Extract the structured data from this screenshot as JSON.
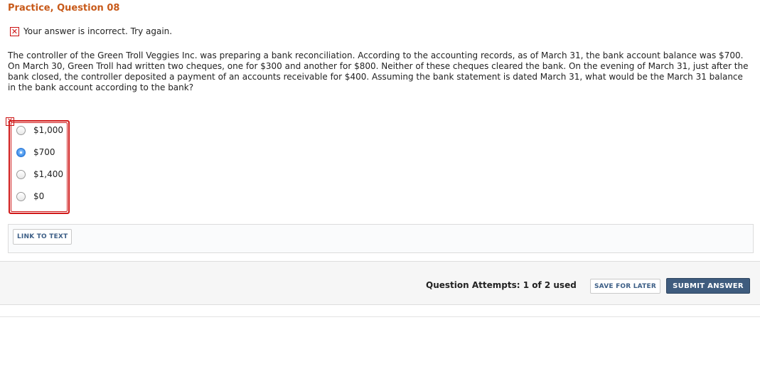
{
  "question": {
    "title": "Practice, Question 08",
    "feedback_icon": "x-icon",
    "feedback_text": "Your answer is incorrect.  Try again.",
    "text": "The controller of the Green Troll Veggies Inc. was preparing a bank reconciliation. According to the accounting records, as of March 31, the bank account balance was $700. On March 30, Green Troll had written two cheques, one for $300 and another for $800. Neither of these cheques cleared the bank. On the evening of March 31, just after the bank closed, the controller deposited a payment of an accounts receivable for $400. Assuming the bank statement is dated March 31, what would be the March 31 balance in the bank account according to the bank?"
  },
  "choices": {
    "marker_icon": "x-icon",
    "selected_index": 1,
    "items": [
      {
        "label": "$1,000"
      },
      {
        "label": "$700"
      },
      {
        "label": "$1,400"
      },
      {
        "label": "$0"
      }
    ]
  },
  "links": {
    "link_to_text": "LINK TO TEXT"
  },
  "footer": {
    "attempts": "Question Attempts: 1 of 2 used",
    "save_label": "SAVE FOR LATER",
    "submit_label": "SUBMIT ANSWER"
  },
  "colors": {
    "title": "#c85a1a",
    "error": "#d01818",
    "submit_bg": "#3f5c7e",
    "button_text": "#3c5e86",
    "radio_selected": "#3b8be8"
  }
}
